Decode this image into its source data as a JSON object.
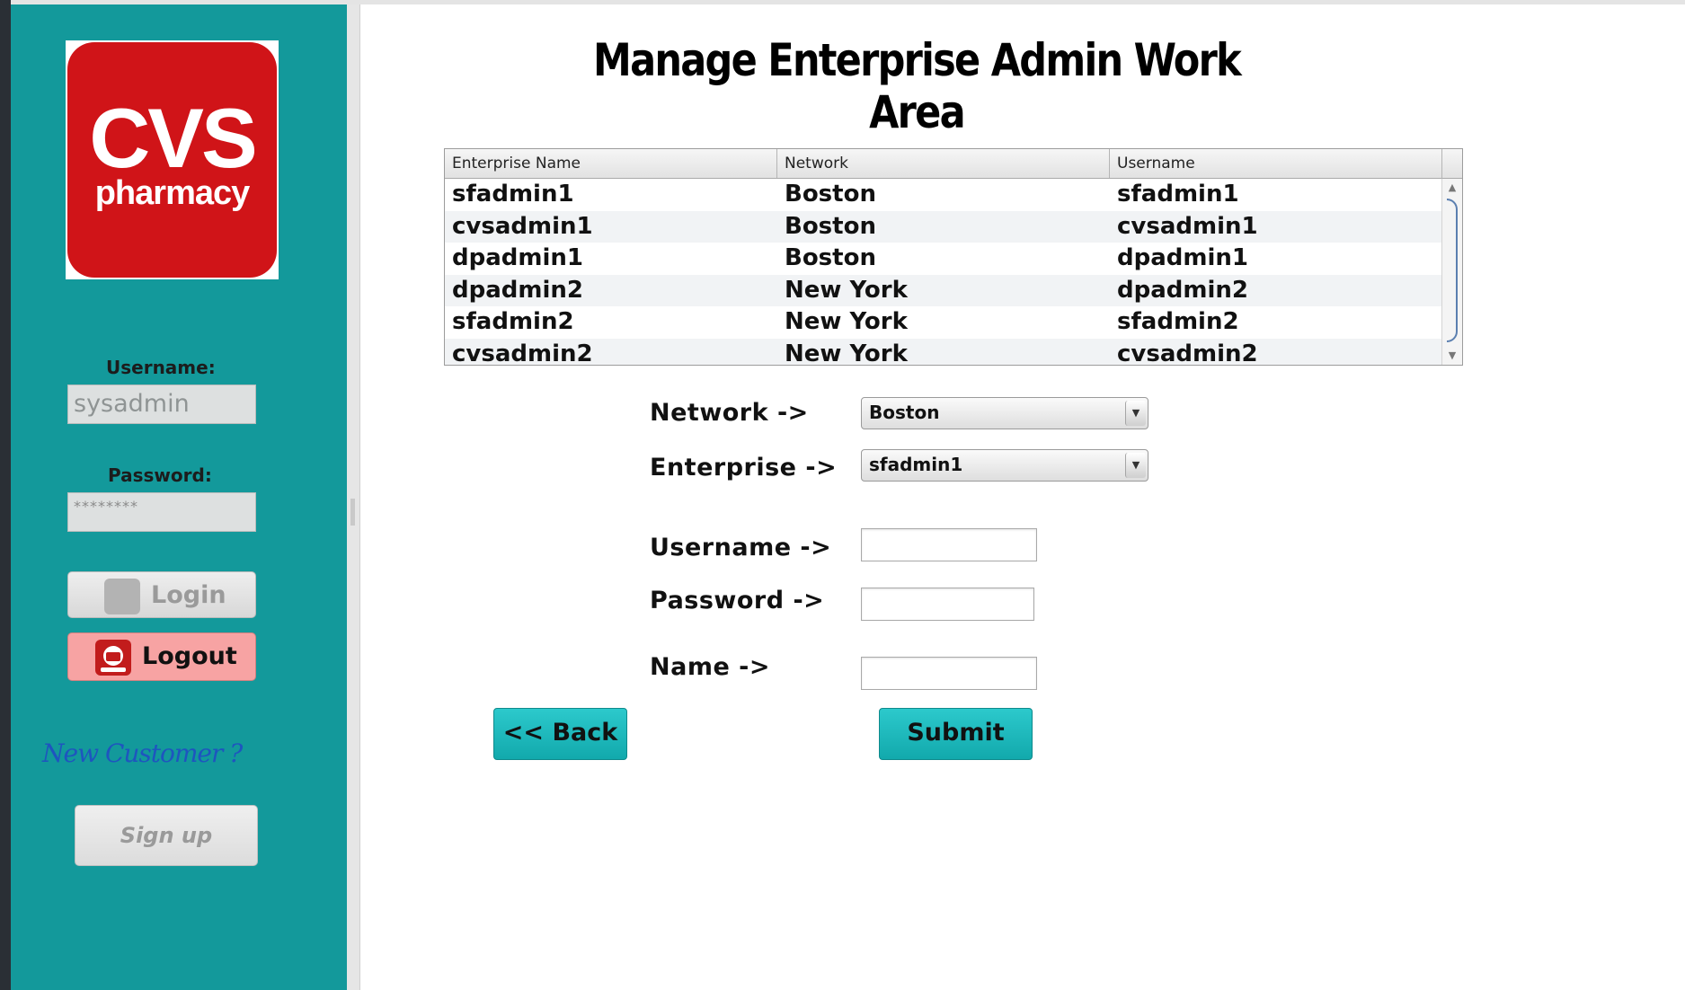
{
  "app": {
    "logo": {
      "brand": "CVS",
      "sub": "pharmacy"
    }
  },
  "sidebar": {
    "username_label": "Username:",
    "username_value": "sysadmin",
    "password_label": "Password:",
    "password_value": "********",
    "login_label": "Login",
    "logout_label": "Logout",
    "new_customer_label": "New Customer ?",
    "signup_label": "Sign up",
    "colors": {
      "background": "#13999b",
      "logout_bg": "#f7a3a3",
      "link": "#1e55bf"
    },
    "icons": {
      "login": "user-lock-icon",
      "logout": "exit-door-icon"
    }
  },
  "main": {
    "title": "Manage Enterprise Admin Work Area",
    "table": {
      "columns": [
        "Enterprise Name",
        "Network",
        "Username"
      ],
      "rows": [
        [
          "sfadmin1",
          "Boston",
          "sfadmin1"
        ],
        [
          "cvsadmin1",
          "Boston",
          "cvsadmin1"
        ],
        [
          "dpadmin1",
          "Boston",
          "dpadmin1"
        ],
        [
          "dpadmin2",
          "New York",
          "dpadmin2"
        ],
        [
          "sfadmin2",
          "New York",
          "sfadmin2"
        ],
        [
          "cvsadmin2",
          "New York",
          "cvsadmin2"
        ]
      ]
    },
    "form": {
      "network_label": "Network ->",
      "network_value": "Boston",
      "enterprise_label": "Enterprise ->",
      "enterprise_value": "sfadmin1",
      "username_label": "Username ->",
      "username_value": "",
      "password_label": "Password ->",
      "password_value": "",
      "name_label": "Name ->",
      "name_value": ""
    },
    "back_label": "<< Back",
    "submit_label": "Submit",
    "colors": {
      "button": "#12a9ac"
    }
  }
}
